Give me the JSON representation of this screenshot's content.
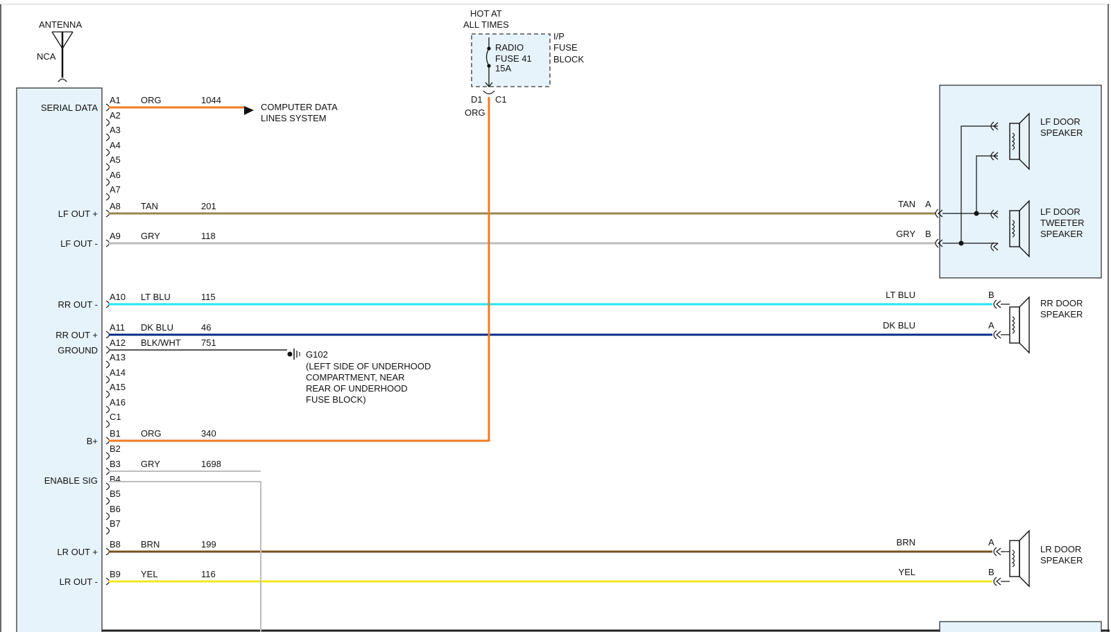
{
  "colors": {
    "ORG": "#f47a20",
    "TAN": "#9a8550",
    "GRY": "#bdbdbd",
    "LT BLU": "#22e5f2",
    "DK BLU": "#0a2a88",
    "BLK/WHT": "#555555",
    "BRN": "#7a4e1a",
    "YEL": "#f2e71e",
    "box_fill": "#e6f3fb",
    "box_stroke": "#333333"
  },
  "antenna": {
    "label": "ANTENNA",
    "sub": "NCA"
  },
  "fuse": {
    "hot_line1": "HOT AT",
    "hot_line2": "ALL TIMES",
    "name_line1": "RADIO",
    "name_line2": "FUSE 41",
    "name_line3": "15A",
    "block_line1": "I/P",
    "block_line2": "FUSE",
    "block_line3": "BLOCK",
    "pin_left": "D1",
    "pin_right": "C1",
    "wire_color": "ORG"
  },
  "radio": {
    "pins": [
      {
        "pin": "A1",
        "label": "SERIAL DATA",
        "color": "ORG",
        "circuit": "1044"
      },
      {
        "pin": "A2"
      },
      {
        "pin": "A3"
      },
      {
        "pin": "A4"
      },
      {
        "pin": "A5"
      },
      {
        "pin": "A6"
      },
      {
        "pin": "A7"
      },
      {
        "pin": "A8",
        "label": "LF OUT +",
        "color": "TAN",
        "circuit": "201"
      },
      {
        "pin": "A9",
        "label": "LF OUT -",
        "color": "GRY",
        "circuit": "118"
      },
      {
        "pin": "A10",
        "label": "RR OUT -",
        "color": "LT BLU",
        "circuit": "115"
      },
      {
        "pin": "A11",
        "label": "RR OUT +",
        "color": "DK BLU",
        "circuit": "46"
      },
      {
        "pin": "A12",
        "label": "GROUND",
        "color": "BLK/WHT",
        "circuit": "751"
      },
      {
        "pin": "A13"
      },
      {
        "pin": "A14"
      },
      {
        "pin": "A15"
      },
      {
        "pin": "A16"
      },
      {
        "pin": "C1"
      },
      {
        "pin": "B1",
        "label": "B+",
        "color": "ORG",
        "circuit": "340"
      },
      {
        "pin": "B2"
      },
      {
        "pin": "B3",
        "color": "GRY",
        "circuit": "1698"
      },
      {
        "pin": "B4",
        "label": "ENABLE SIG"
      },
      {
        "pin": "B5"
      },
      {
        "pin": "B6"
      },
      {
        "pin": "B7"
      },
      {
        "pin": "B8",
        "label": "LR OUT +",
        "color": "BRN",
        "circuit": "199"
      },
      {
        "pin": "B9",
        "label": "LR OUT -",
        "color": "YEL",
        "circuit": "116"
      }
    ]
  },
  "computer_data": {
    "line1": "COMPUTER DATA",
    "line2": "LINES SYSTEM"
  },
  "ground": {
    "name": "G102",
    "desc_line1": "(LEFT SIDE OF UNDERHOOD",
    "desc_line2": "COMPARTMENT, NEAR",
    "desc_line3": "REAR OF UNDERHOOD",
    "desc_line4": "FUSE BLOCK)"
  },
  "speakers": {
    "lf_door": {
      "line1": "LF DOOR",
      "line2": "SPEAKER"
    },
    "lf_tweeter": {
      "line1": "LF DOOR",
      "line2": "TWEETER",
      "line3": "SPEAKER"
    },
    "rr_door": {
      "line1": "RR DOOR",
      "line2": "SPEAKER"
    },
    "lr_door": {
      "line1": "LR DOOR",
      "line2": "SPEAKER"
    }
  },
  "speaker_wires": [
    {
      "color": "TAN",
      "term": "A"
    },
    {
      "color": "GRY",
      "term": "B"
    },
    {
      "color": "LT BLU",
      "term": "B"
    },
    {
      "color": "DK BLU",
      "term": "A"
    },
    {
      "color": "BRN",
      "term": "A"
    },
    {
      "color": "YEL",
      "term": "B"
    }
  ]
}
